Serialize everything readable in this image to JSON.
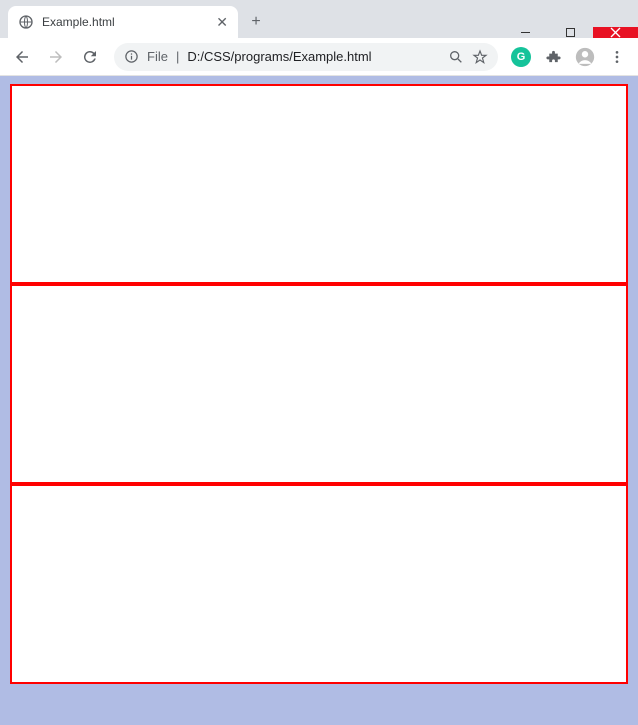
{
  "window": {
    "minimize_label": "–",
    "maximize_label": "▢",
    "close_label": "✕"
  },
  "tab": {
    "title": "Example.html",
    "close_label": "✕"
  },
  "newtab_label": "+",
  "toolbar": {
    "file_prefix": "File",
    "divider": "|",
    "url": "D:/CSS/programs/Example.html"
  },
  "boxes": [
    {
      "position": "left"
    },
    {
      "position": "center"
    },
    {
      "position": "right"
    }
  ]
}
